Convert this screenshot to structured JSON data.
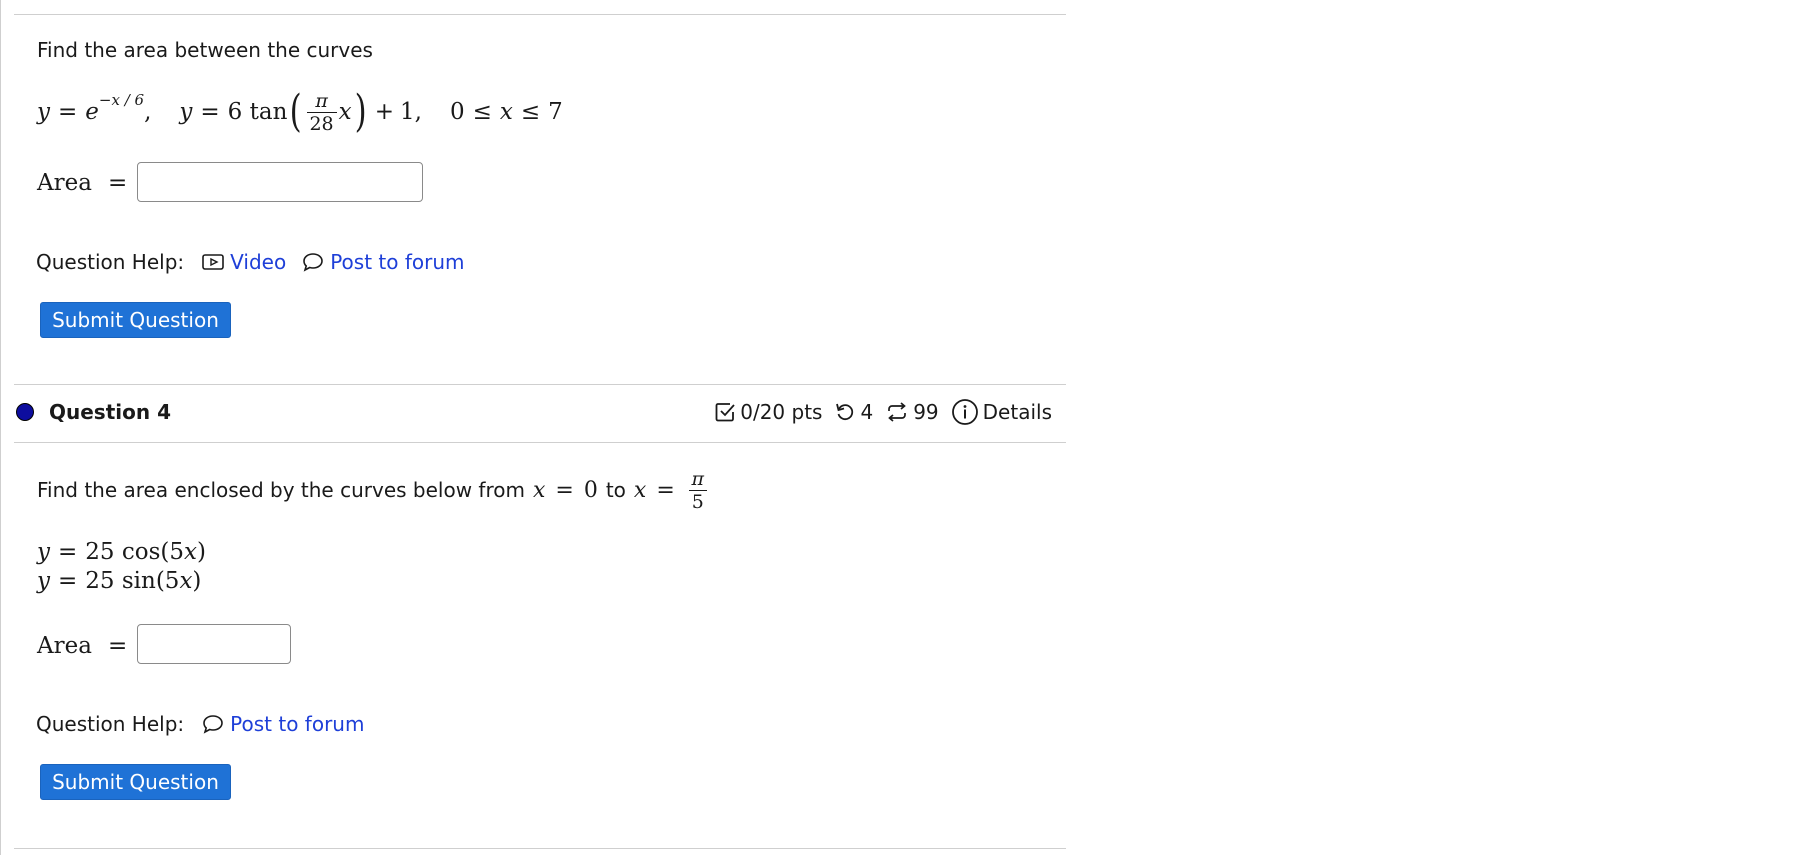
{
  "q3": {
    "prompt": "Find the area between the curves",
    "area_label": "Area",
    "equals": "=",
    "help_label": "Question Help:",
    "video_link": "Video",
    "forum_link": "Post to forum",
    "submit_label": "Submit Question",
    "answer_value": ""
  },
  "q4": {
    "title": "Question 4",
    "points": "0/20 pts",
    "retries": "4",
    "attempts": "99",
    "details": "Details",
    "prompt_lead": "Find the area enclosed by the curves below from",
    "prompt_to": "to",
    "area_label": "Area",
    "equals": "=",
    "help_label": "Question Help:",
    "forum_link": "Post to forum",
    "submit_label": "Submit Question",
    "answer_value": ""
  },
  "colors": {
    "link": "#1e3fd8",
    "button": "#1f72d6",
    "status_dot": "#0d0d9e"
  }
}
